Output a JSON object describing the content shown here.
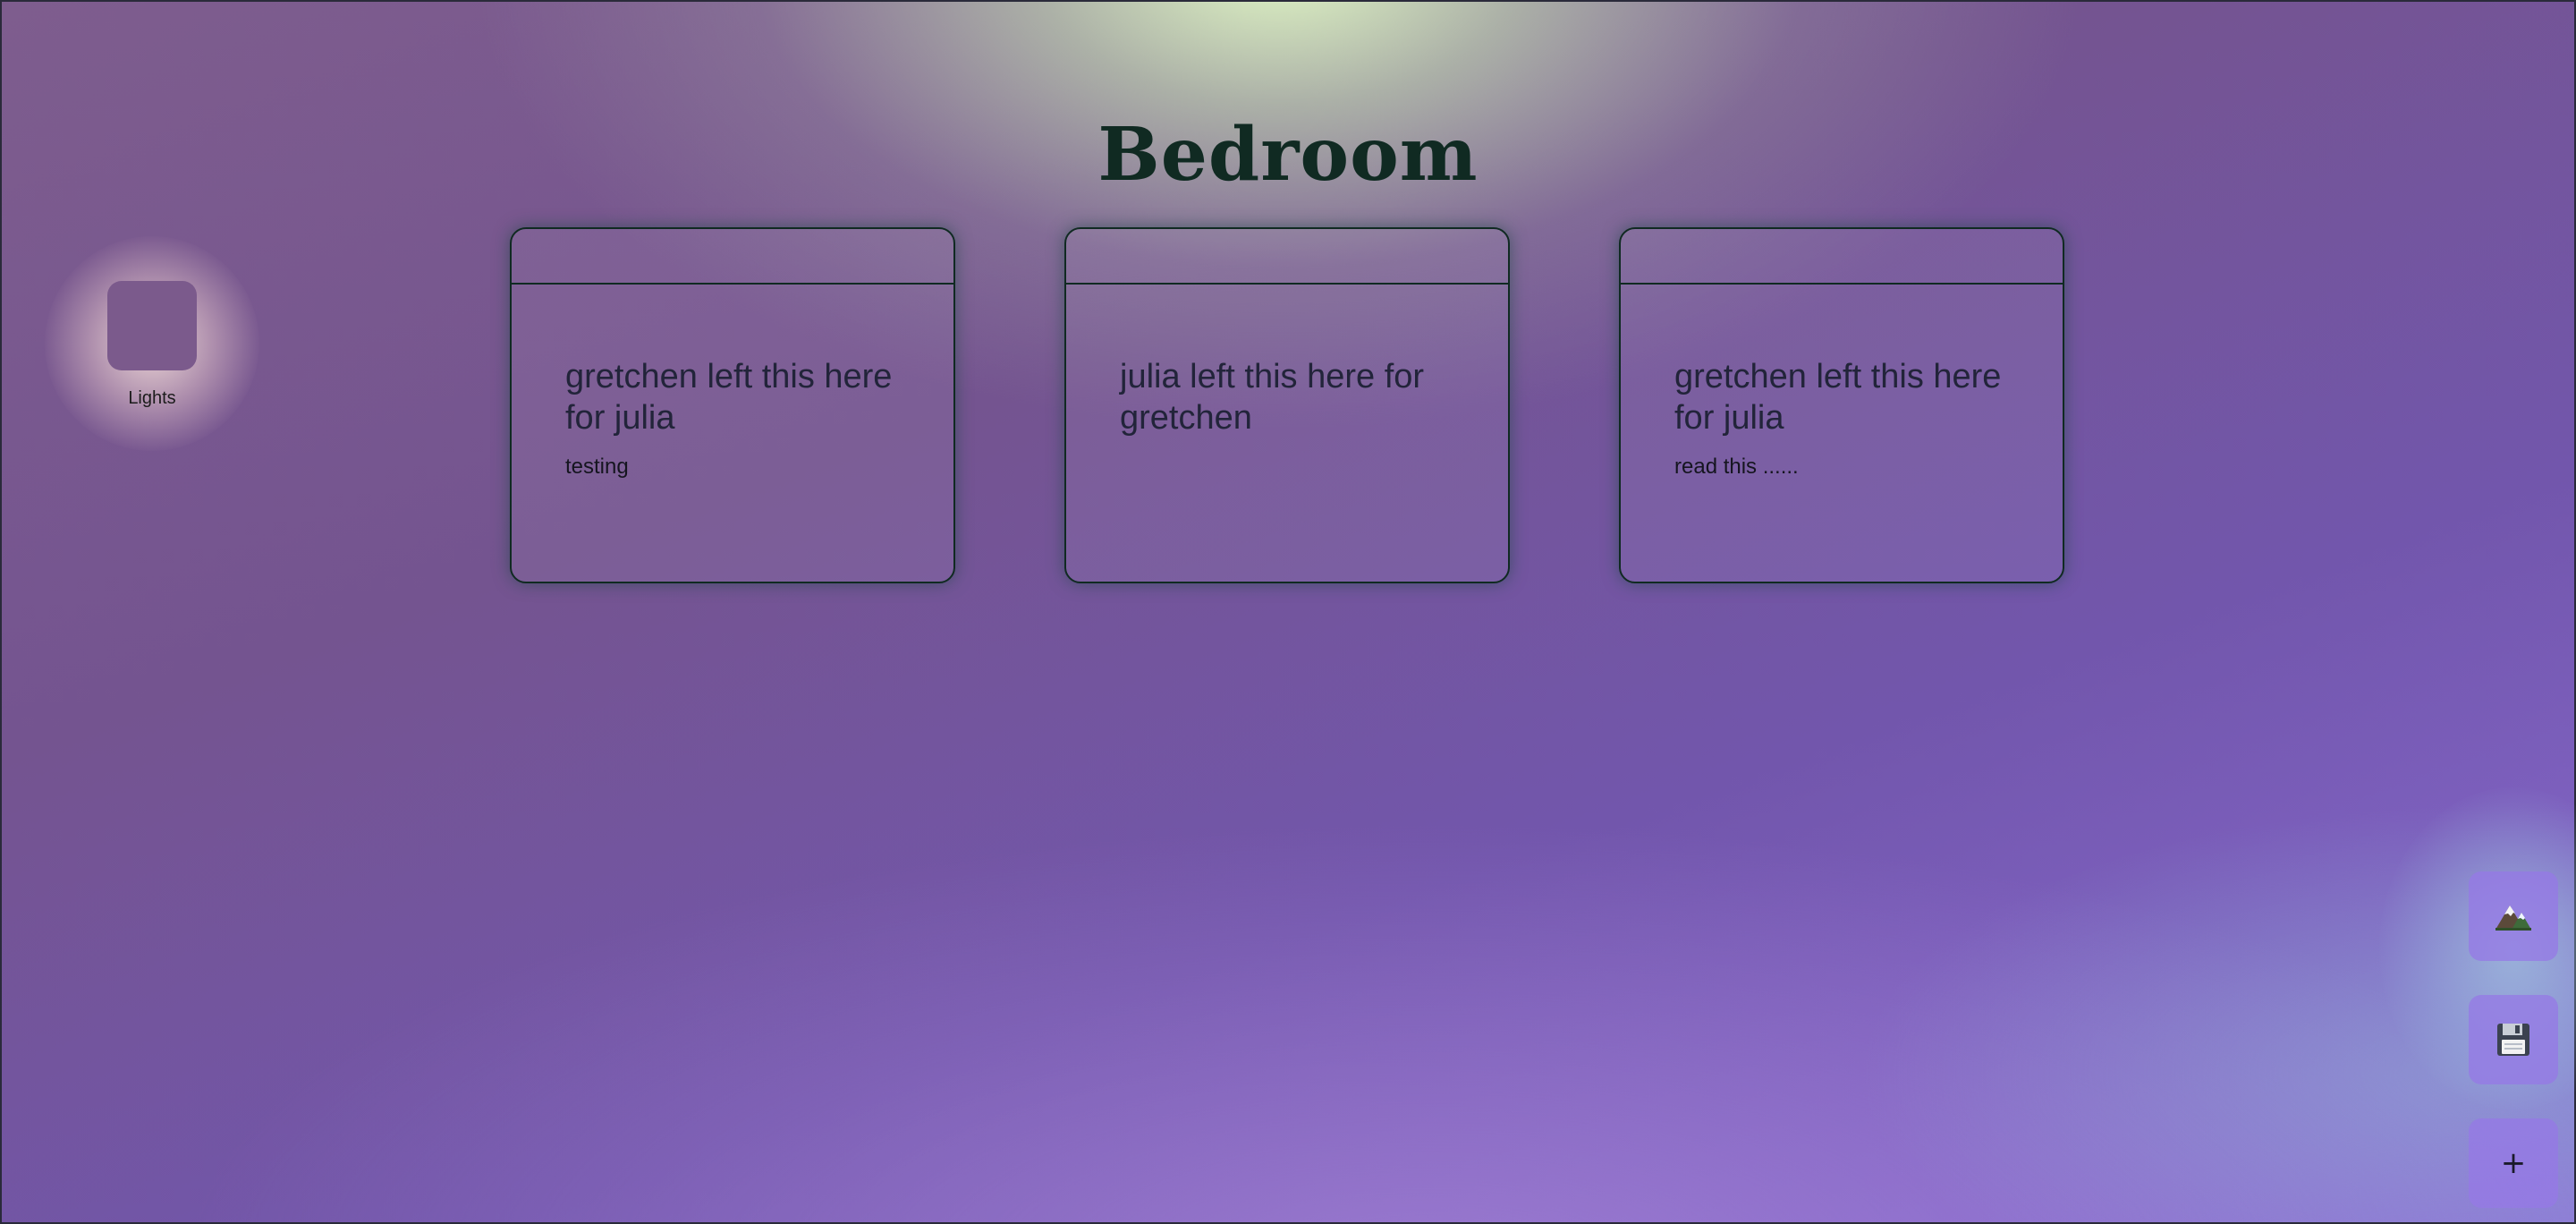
{
  "page": {
    "title": "Bedroom"
  },
  "devices": [
    {
      "label": "Lights"
    }
  ],
  "notes": [
    {
      "title": "gretchen left this here for julia",
      "text": "testing"
    },
    {
      "title": "julia left this here for gretchen",
      "text": ""
    },
    {
      "title": "gretchen left this here for julia",
      "text": "read this ......"
    }
  ],
  "actions": {
    "background_icon": "mountain-icon",
    "save_icon": "floppy-disk-icon",
    "add_label": "+"
  }
}
